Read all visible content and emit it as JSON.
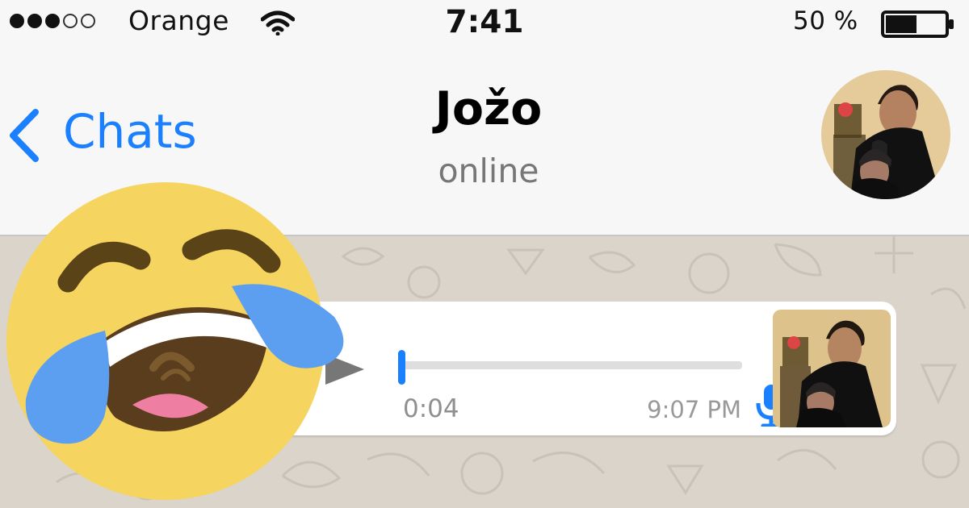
{
  "status_bar": {
    "carrier": "Orange",
    "signal": {
      "filled": 3,
      "total": 5
    },
    "time": "7:41",
    "battery_percent": "50 %",
    "battery_level": 0.5,
    "icons": {
      "wifi": "wifi-icon",
      "battery": "battery-icon"
    }
  },
  "header": {
    "back_label": "Chats",
    "contact_name": "Jožo",
    "contact_status": "online",
    "back_icon": "chevron-left-icon",
    "avatar_icon": "contact-avatar"
  },
  "message": {
    "type": "voice-message",
    "duration": "0:04",
    "time": "9:07 PM",
    "progress": 0,
    "icons": {
      "play": "play-icon",
      "microphone": "microphone-icon",
      "sender_photo": "sender-avatar"
    }
  },
  "overlay": {
    "emoji": "face-with-tears-of-joy-icon"
  },
  "colors": {
    "accent": "#1a80ff",
    "background": "#f7f7f7",
    "chat_background": "#dad4cb",
    "emoji_yellow": "#f5d45f",
    "tears": "#5c9ff0"
  }
}
